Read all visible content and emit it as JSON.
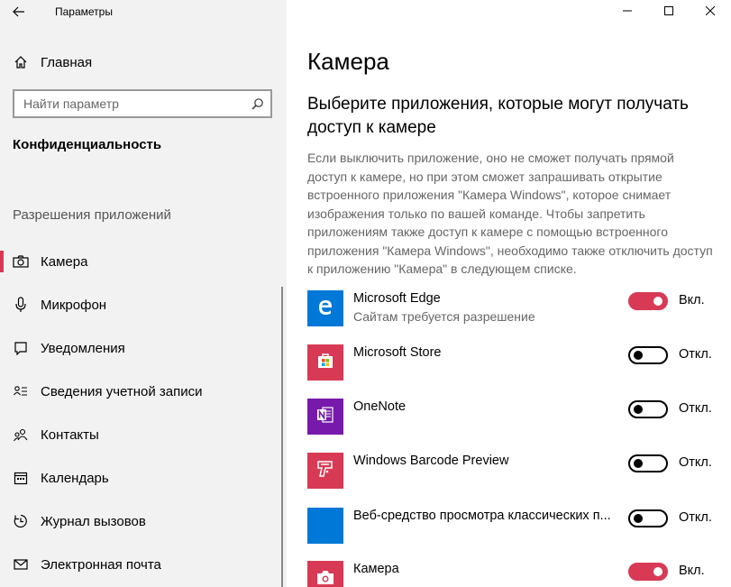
{
  "window": {
    "title": "Параметры"
  },
  "sidebar": {
    "home_label": "Главная",
    "search_placeholder": "Найти параметр",
    "section_title": "Конфиденциальность",
    "group_title": "Разрешения приложений",
    "items": [
      {
        "label": "Камера",
        "icon": "camera-icon",
        "active": true
      },
      {
        "label": "Микрофон",
        "icon": "microphone-icon"
      },
      {
        "label": "Уведомления",
        "icon": "notification-icon"
      },
      {
        "label": "Сведения учетной записи",
        "icon": "account-info-icon"
      },
      {
        "label": "Контакты",
        "icon": "contacts-icon"
      },
      {
        "label": "Календарь",
        "icon": "calendar-icon"
      },
      {
        "label": "Журнал вызовов",
        "icon": "call-history-icon"
      },
      {
        "label": "Электронная почта",
        "icon": "email-icon"
      }
    ]
  },
  "main": {
    "title": "Камера",
    "subheading": "Выберите приложения, которые могут получать доступ к камере",
    "description": "Если выключить приложение, оно не сможет получать прямой доступ к камере, но при этом сможет запрашивать открытие встроенного приложения \"Камера Windows\", которое снимает изображения только по вашей команде. Чтобы запретить приложениям также доступ к камере с помощью встроенного приложения \"Камера Windows\", необходимо также отключить доступ к приложению \"Камера\" в следующем списке.",
    "apps": [
      {
        "name": "Microsoft Edge",
        "subtitle": "Сайтам требуется разрешение",
        "state": "Вкл.",
        "on": true,
        "tile_color": "#0078d7",
        "icon": "edge-icon"
      },
      {
        "name": "Microsoft Store",
        "subtitle": "",
        "state": "Откл.",
        "on": false,
        "tile_color": "#d83a55",
        "icon": "store-icon"
      },
      {
        "name": "OneNote",
        "subtitle": "",
        "state": "Откл.",
        "on": false,
        "tile_color": "#7719aa",
        "icon": "onenote-icon"
      },
      {
        "name": "Windows Barcode Preview",
        "subtitle": "",
        "state": "Откл.",
        "on": false,
        "tile_color": "#d83a55",
        "icon": "barcode-scanner-icon"
      },
      {
        "name": "Веб-средство просмотра классических п...",
        "subtitle": "",
        "state": "Откл.",
        "on": false,
        "tile_color": "#0078d7",
        "icon": "blank-app-icon"
      },
      {
        "name": "Камера",
        "subtitle": "",
        "state": "Вкл.",
        "on": true,
        "tile_color": "#d83a55",
        "icon": "camera-app-icon"
      }
    ]
  },
  "colors": {
    "accent": "#d83a55",
    "sidebar_bg": "#f2f2f2"
  }
}
